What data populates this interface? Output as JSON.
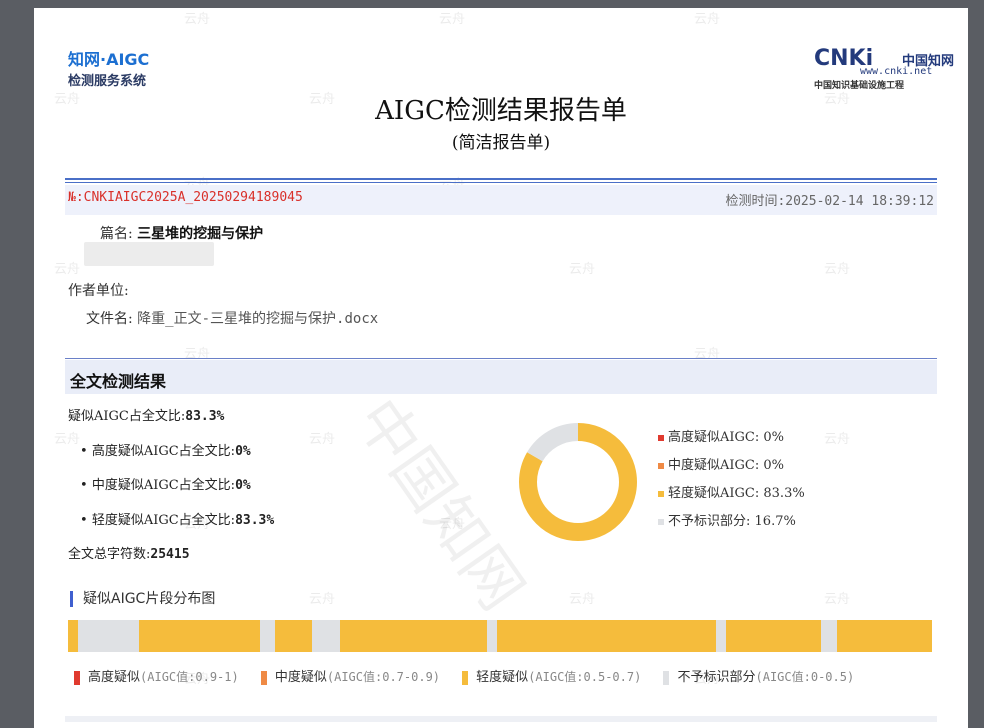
{
  "header": {
    "logo_left_line1": "知网·AIGC",
    "logo_left_line2": "检测服务系统",
    "logo_right_brand": "CNKi",
    "logo_right_cn": "中国知网",
    "logo_right_url": "www.cnki.net",
    "logo_right_tagline": "中国知识基础设施工程"
  },
  "title": "AIGC检测结果报告单",
  "subtitle": "(简洁报告单)",
  "report_no": "№:CNKIAIGC2025A_20250294189045",
  "check_time": "检测时间:2025-02-14 18:39:12",
  "fields": {
    "title_label": "篇名:",
    "title_value": "三星堆的挖掘与保护",
    "unit_label": "作者单位:",
    "file_label": "文件名:",
    "file_value": "降重_正文-三星堆的挖掘与保护.docx"
  },
  "section_title": "全文检测结果",
  "stats": {
    "overall_label": "疑似AIGC占全文比:",
    "overall_value": "83.3%",
    "high_label": "高度疑似AIGC占全文比:",
    "high_value": "0%",
    "mid_label": "中度疑似AIGC占全文比:",
    "mid_value": "0%",
    "low_label": "轻度疑似AIGC占全文比:",
    "low_value": "83.3%",
    "chars_label": "全文总字符数:",
    "chars_value": "25415"
  },
  "donut_legend": [
    {
      "label": "高度疑似AIGC:",
      "value": "0%",
      "color": "#e03a2f",
      "fraction": 0
    },
    {
      "label": "中度疑似AIGC:",
      "value": "0%",
      "color": "#ef8a45",
      "fraction": 0
    },
    {
      "label": "轻度疑似AIGC:",
      "value": "83.3%",
      "color": "#f5bc3c",
      "fraction": 0.833
    },
    {
      "label": "不予标识部分:",
      "value": "16.7%",
      "color": "#dfe1e4",
      "fraction": 0.167
    }
  ],
  "distribution": {
    "title": "疑似AIGC片段分布图",
    "segments": [
      {
        "kind": "light",
        "fraction": 0.012
      },
      {
        "kind": "none",
        "fraction": 0.07
      },
      {
        "kind": "light",
        "fraction": 0.14
      },
      {
        "kind": "none",
        "fraction": 0.018
      },
      {
        "kind": "light",
        "fraction": 0.042
      },
      {
        "kind": "none",
        "fraction": 0.033
      },
      {
        "kind": "light",
        "fraction": 0.17
      },
      {
        "kind": "none",
        "fraction": 0.011
      },
      {
        "kind": "light",
        "fraction": 0.254
      },
      {
        "kind": "none",
        "fraction": 0.012
      },
      {
        "kind": "light",
        "fraction": 0.11
      },
      {
        "kind": "none",
        "fraction": 0.018
      },
      {
        "kind": "light",
        "fraction": 0.11
      }
    ],
    "colors": {
      "light": "#f5bc3c",
      "none": "#dfe1e4"
    },
    "legend": [
      {
        "label": "高度疑似",
        "hint": "(AIGC值:0.9-1)",
        "color": "#e03a2f"
      },
      {
        "label": "中度疑似",
        "hint": "(AIGC值:0.7-0.9)",
        "color": "#ef8a45"
      },
      {
        "label": "轻度疑似",
        "hint": "(AIGC值:0.5-0.7)",
        "color": "#f5bc3c"
      },
      {
        "label": "不予标识部分",
        "hint": "(AIGC值:0-0.5)",
        "color": "#dfe1e4"
      }
    ]
  },
  "watermark": {
    "small": "云舟",
    "large": "中国知网"
  }
}
